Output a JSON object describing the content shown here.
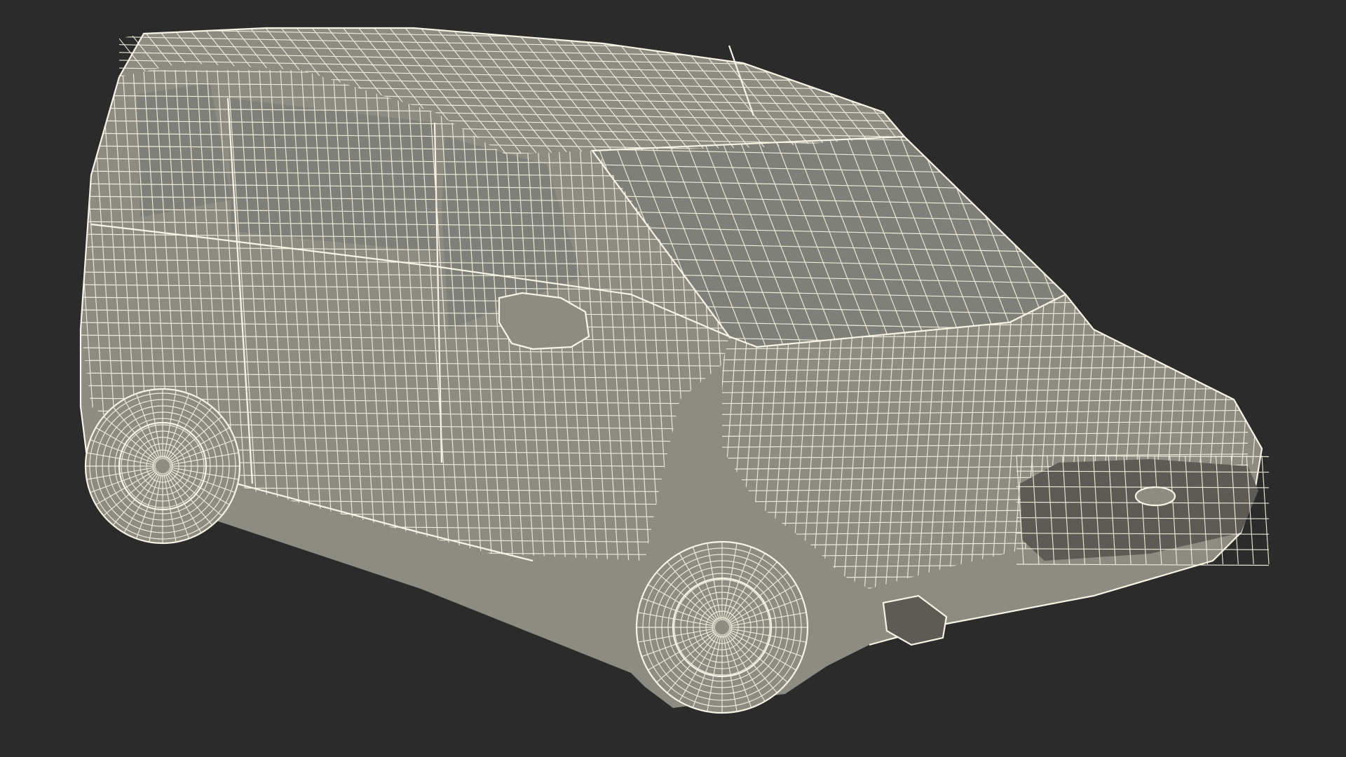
{
  "scene": {
    "subject": "van-wireframe-model",
    "colors": {
      "background": "#2b2b2b",
      "body": "#8d8c82",
      "wire": "#f4f1df",
      "dark_parts": "#5c5b55"
    }
  }
}
